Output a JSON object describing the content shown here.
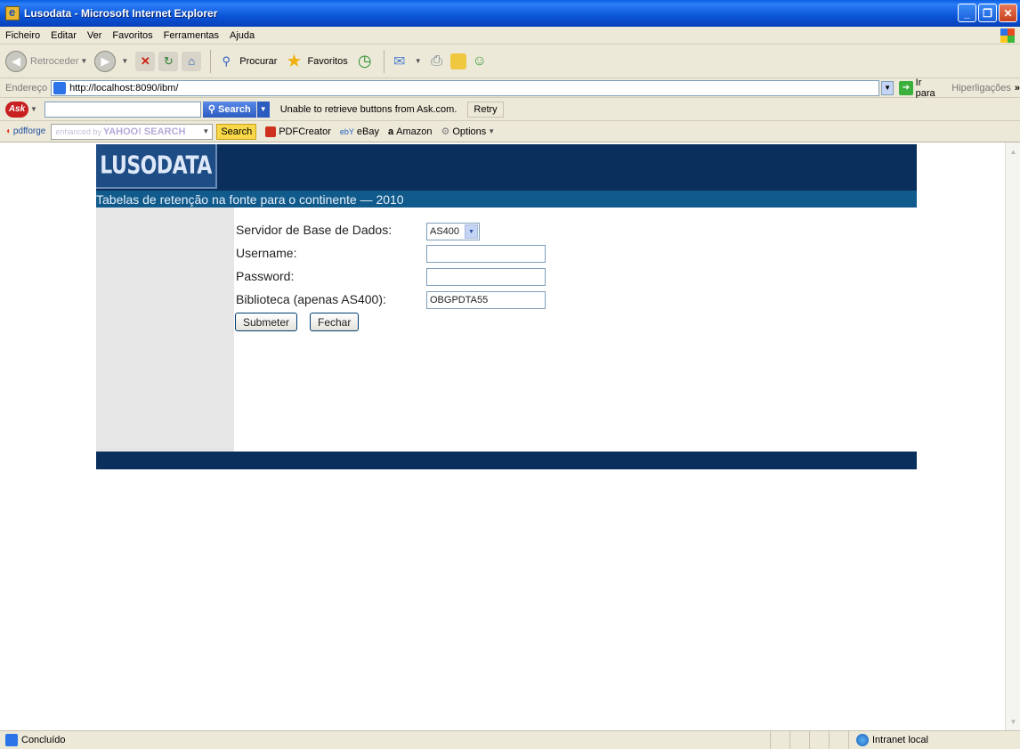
{
  "window": {
    "title": "Lusodata - Microsoft Internet Explorer"
  },
  "menu": [
    "Ficheiro",
    "Editar",
    "Ver",
    "Favoritos",
    "Ferramentas",
    "Ajuda"
  ],
  "toolbar": {
    "back_label": "Retroceder",
    "search_label": "Procurar",
    "favorites_label": "Favoritos"
  },
  "address": {
    "label": "Endereço",
    "url": "http://localhost:8090/ibm/",
    "go_label": "Ir para",
    "links_label": "Hiperligações"
  },
  "ask": {
    "logo": "Ask",
    "search_label": "Search",
    "message": "Unable to retrieve buttons from Ask.com.",
    "retry_label": "Retry"
  },
  "pdfforge": {
    "logo": "pdfforge",
    "yahoo_prefix": "enhanced by",
    "yahoo_brand": "YAHOO! SEARCH",
    "search_label": "Search",
    "pdfcreator_label": "PDFCreator",
    "ebay_label": "eBay",
    "amazon_label": "Amazon",
    "options_label": "Options"
  },
  "page": {
    "logo": "LUSODATA",
    "subtitle": "Tabelas de retenção na fonte para o continente — 2010",
    "form": {
      "db_server_label": "Servidor de Base de Dados:",
      "db_server_value": "AS400",
      "username_label": "Username:",
      "username_value": "",
      "password_label": "Password:",
      "password_value": "",
      "library_label": "Biblioteca (apenas AS400):",
      "library_value": "OBGPDTA55",
      "submit_label": "Submeter",
      "close_label": "Fechar"
    }
  },
  "status": {
    "left": "Concluído",
    "zone": "Intranet local"
  }
}
